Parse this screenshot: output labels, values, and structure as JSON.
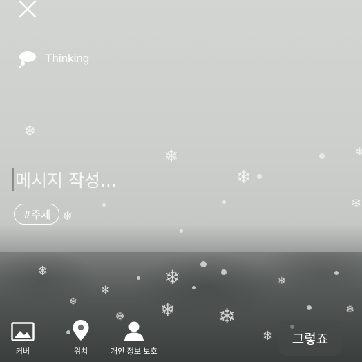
{
  "header": {
    "close_icon": "close-icon"
  },
  "topic": {
    "icon": "thought-bubble-icon",
    "label": "Thinking"
  },
  "composer": {
    "placeholder": "메시지 작성..."
  },
  "hashtag": {
    "label": "#주제"
  },
  "toolbar": {
    "items": [
      {
        "icon": "image-icon",
        "label": "커버"
      },
      {
        "icon": "location-pin-icon",
        "label": "위치"
      },
      {
        "icon": "person-icon",
        "label": "개인 정보 보호"
      }
    ],
    "submit_label": "그렇죠"
  }
}
